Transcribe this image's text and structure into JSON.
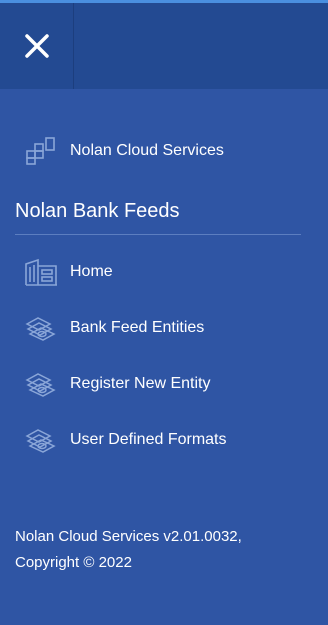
{
  "header": {
    "close_icon": "close-icon"
  },
  "nav": {
    "cloud_services": {
      "label": "Nolan Cloud Services",
      "icon": "grid-blocks-icon"
    },
    "section_title": "Nolan Bank Feeds",
    "items": [
      {
        "label": "Home",
        "icon": "building-icon"
      },
      {
        "label": "Bank Feed Entities",
        "icon": "banknotes-icon"
      },
      {
        "label": "Register New Entity",
        "icon": "banknotes-icon"
      },
      {
        "label": "User Defined Formats",
        "icon": "banknotes-icon"
      }
    ]
  },
  "footer": {
    "version_line": "Nolan Cloud Services v2.01.0032,",
    "copyright_line": "Copyright © 2022"
  },
  "colors": {
    "background": "#2f55a4",
    "header": "#234a92",
    "accent_top": "#4a8fe0",
    "icon": "#8aa6d8"
  }
}
